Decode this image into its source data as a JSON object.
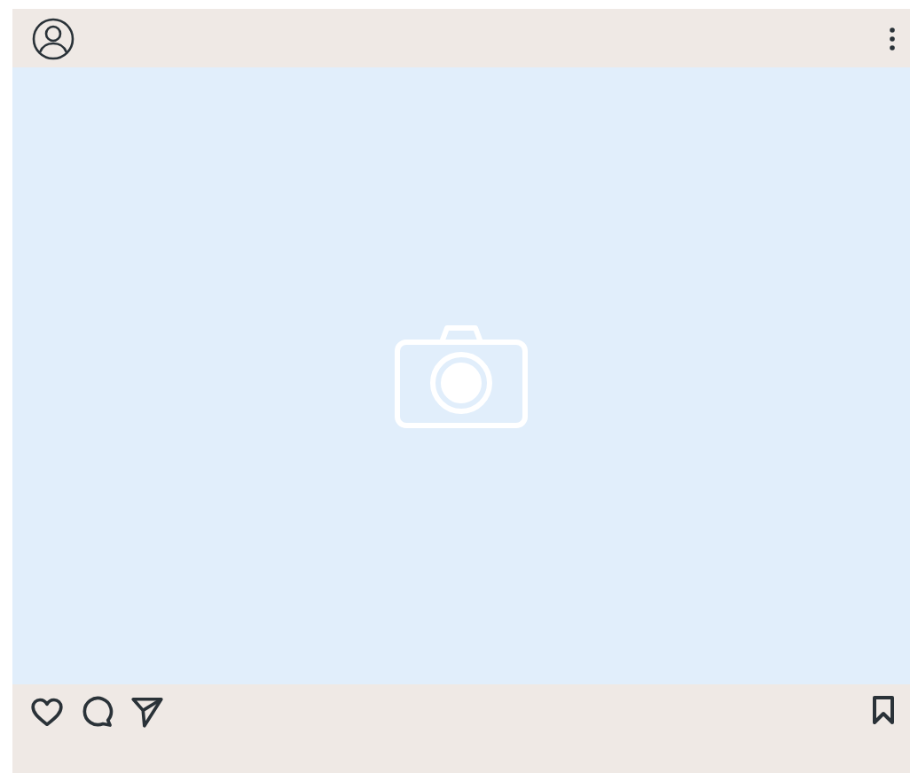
{
  "post": {
    "media": {
      "kind": "placeholder"
    },
    "actions": {
      "liked": false,
      "saved": false
    }
  }
}
